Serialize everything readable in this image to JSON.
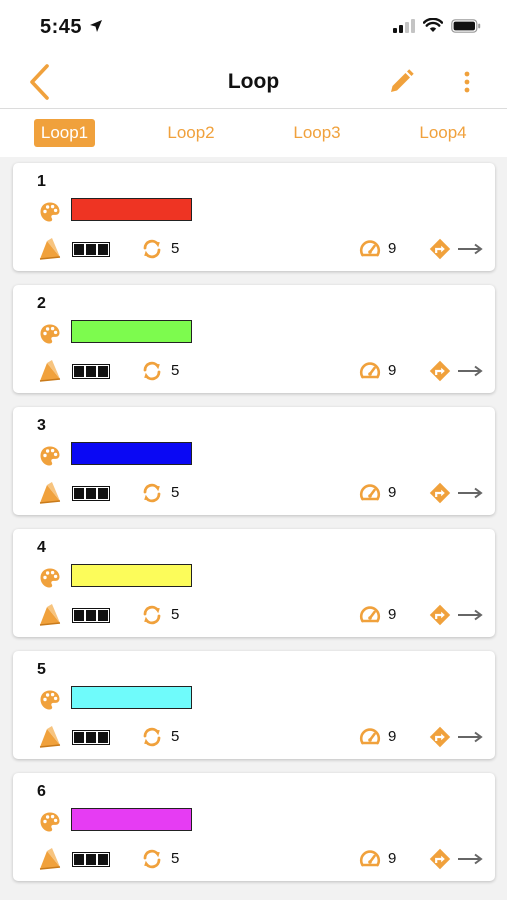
{
  "status": {
    "time": "5:45"
  },
  "nav": {
    "title": "Loop"
  },
  "tabs": [
    {
      "label": "Loop1",
      "active": true
    },
    {
      "label": "Loop2",
      "active": false
    },
    {
      "label": "Loop3",
      "active": false
    },
    {
      "label": "Loop4",
      "active": false
    }
  ],
  "colors": {
    "accent": "#f0a13c"
  },
  "steps": [
    {
      "number": "1",
      "color": "#ee3423",
      "repeat": "5",
      "speed": "9"
    },
    {
      "number": "2",
      "color": "#7dfb4e",
      "repeat": "5",
      "speed": "9"
    },
    {
      "number": "3",
      "color": "#0a08f4",
      "repeat": "5",
      "speed": "9"
    },
    {
      "number": "4",
      "color": "#fcfc5a",
      "repeat": "5",
      "speed": "9"
    },
    {
      "number": "5",
      "color": "#6ffbfb",
      "repeat": "5",
      "speed": "9"
    },
    {
      "number": "6",
      "color": "#e63cf3",
      "repeat": "5",
      "speed": "9"
    }
  ],
  "icons": {
    "back": "chevron-left-icon",
    "edit": "pencil-icon",
    "more": "more-vertical-icon",
    "color": "palette-icon",
    "fill": "paint-fill-icon",
    "repeat": "repeat-icon",
    "speed": "speedometer-icon",
    "next": "turn-right-icon",
    "arrow": "arrow-right-icon"
  }
}
